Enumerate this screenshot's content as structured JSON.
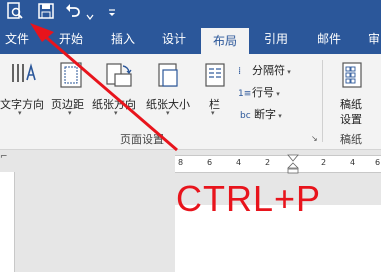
{
  "qat": {
    "icons": [
      "print-preview-icon",
      "save-icon",
      "undo-icon",
      "chevron-down-icon",
      "customize-qat-icon"
    ]
  },
  "tabs": [
    {
      "label": "文件"
    },
    {
      "label": "开始"
    },
    {
      "label": "插入"
    },
    {
      "label": "设计"
    },
    {
      "label": "布局",
      "active": true
    },
    {
      "label": "引用"
    },
    {
      "label": "邮件"
    },
    {
      "label": "审阅"
    }
  ],
  "ribbon": {
    "text_direction": "文字方向",
    "margins": "页边距",
    "orientation": "纸张方向",
    "size": "纸张大小",
    "columns": "栏",
    "breaks": "分隔符",
    "line_numbers": "行号",
    "hyphenation": "断字",
    "page_setup_group": "页面设置",
    "manuscript_line1": "稿纸",
    "manuscript_line2": "设置",
    "manuscript_group": "稿纸"
  },
  "ruler": {
    "ticks_left": [
      "8",
      "6",
      "4",
      "2"
    ],
    "ticks_right": [
      "2",
      "4",
      "6"
    ]
  },
  "annotation": {
    "shortcut_text": "CTRL+P",
    "color": "#e8141c"
  },
  "colors": {
    "titlebar": "#2b579a",
    "ribbon_bg": "#f3f3f3"
  }
}
